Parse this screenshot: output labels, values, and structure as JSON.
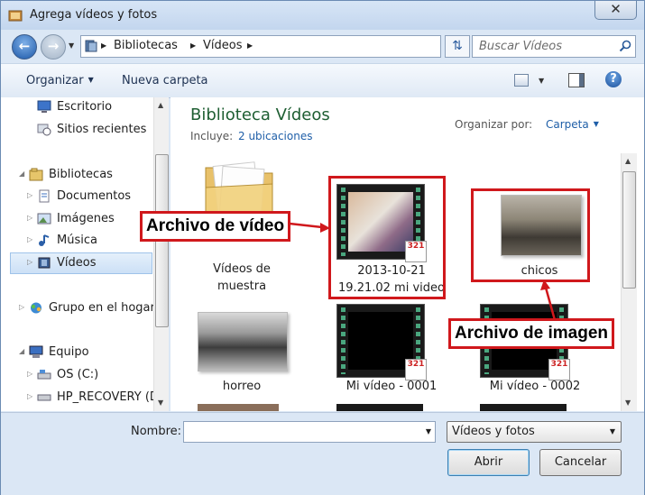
{
  "window": {
    "title": "Agrega vídeos y fotos",
    "close_label": "✕"
  },
  "address": {
    "crumbs": [
      "Bibliotecas",
      "Vídeos"
    ],
    "search_placeholder": "Buscar Vídeos"
  },
  "toolbar": {
    "organize_label": "Organizar",
    "new_folder_label": "Nueva carpeta",
    "help_label": "?"
  },
  "navigation": {
    "items": [
      {
        "label": "Escritorio",
        "icon": "desktop-icon"
      },
      {
        "label": "Sitios recientes",
        "icon": "recent-places-icon"
      },
      {
        "label": "Bibliotecas",
        "icon": "libraries-icon"
      },
      {
        "label": "Documentos",
        "icon": "documents-icon"
      },
      {
        "label": "Imágenes",
        "icon": "pictures-icon"
      },
      {
        "label": "Música",
        "icon": "music-icon"
      },
      {
        "label": "Vídeos",
        "icon": "videos-icon",
        "selected": true
      },
      {
        "label": "Grupo en el hogar",
        "icon": "homegroup-icon"
      },
      {
        "label": "Equipo",
        "icon": "computer-icon"
      },
      {
        "label": "OS (C:)",
        "icon": "drive-icon"
      },
      {
        "label": "HP_RECOVERY (D",
        "icon": "drive-icon"
      }
    ]
  },
  "library": {
    "title": "Biblioteca Vídeos",
    "includes_label": "Incluye:",
    "includes_link": "2 ubicaciones",
    "arrange_label": "Organizar por:",
    "arrange_value": "Carpeta"
  },
  "files": [
    {
      "line1": "Vídeos de",
      "line2": "muestra",
      "type": "folder"
    },
    {
      "line1": "2013-10-21",
      "line2": "19.21.02 mi video",
      "type": "video"
    },
    {
      "line1": "chicos",
      "type": "image"
    },
    {
      "line1": "horreo",
      "type": "image"
    },
    {
      "line1": "Mi vídeo - 0001",
      "type": "video"
    },
    {
      "line1": "Mi vídeo - 0002",
      "type": "video"
    }
  ],
  "badge": {
    "top": "321",
    "bottom": ""
  },
  "annotations": {
    "video_callout": "Archivo de vídeo",
    "image_callout": "Archivo de imagen"
  },
  "bottom": {
    "name_label": "Nombre:",
    "name_value": "",
    "filetype_value": "Vídeos y fotos",
    "open_label": "Abrir",
    "cancel_label": "Cancelar"
  },
  "colors": {
    "accent": "#1f5fa8",
    "library_title": "#1e5e32",
    "annotation_red": "#d0181c"
  }
}
